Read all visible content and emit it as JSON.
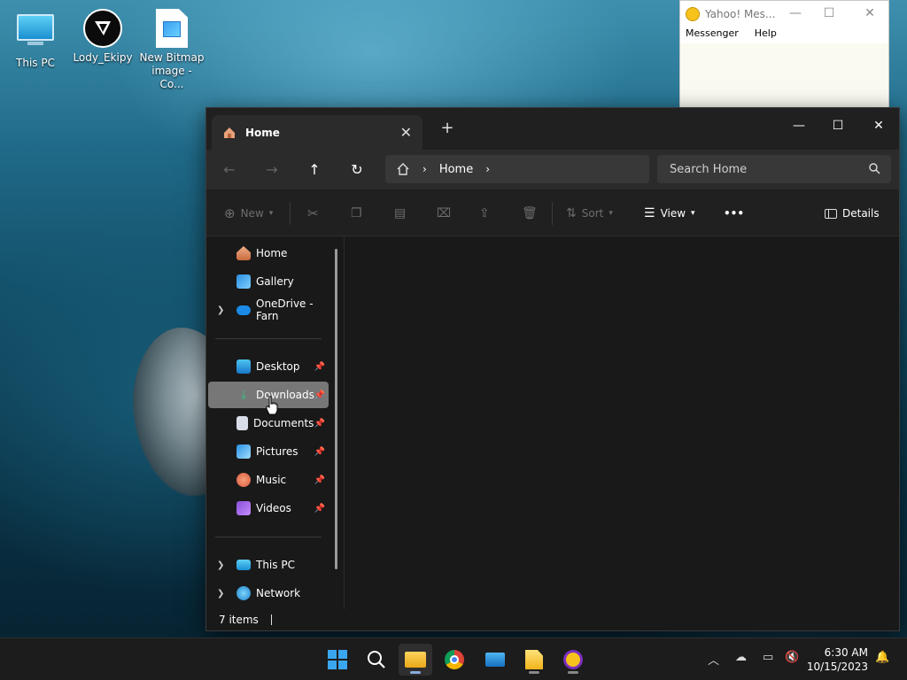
{
  "desktop": {
    "icons": [
      {
        "label": "This PC"
      },
      {
        "label": "Lody_Ekipy"
      },
      {
        "label": "New Bitmap image - Co..."
      }
    ]
  },
  "yahoo": {
    "title": "Yahoo! Mes...",
    "menu": [
      "Messenger",
      "Help"
    ]
  },
  "explorer": {
    "tab_title": "Home",
    "breadcrumb": "Home",
    "search_placeholder": "Search Home",
    "commands": {
      "new": "New",
      "sort": "Sort",
      "view": "View",
      "more": "•••",
      "details": "Details"
    },
    "nav": {
      "top": [
        "Home",
        "Gallery",
        "OneDrive - Farn"
      ],
      "pinned": [
        "Desktop",
        "Downloads",
        "Documents",
        "Pictures",
        "Music",
        "Videos"
      ],
      "bottom": [
        "This PC",
        "Network"
      ],
      "selected": "Downloads"
    },
    "status": "7 items"
  },
  "taskbar": {
    "time": "6:30 AM",
    "date": "10/15/2023"
  },
  "colors": {
    "accent": "#0078d4",
    "explorer_bg": "#191919",
    "taskbar_bg": "#1c1c1c"
  }
}
